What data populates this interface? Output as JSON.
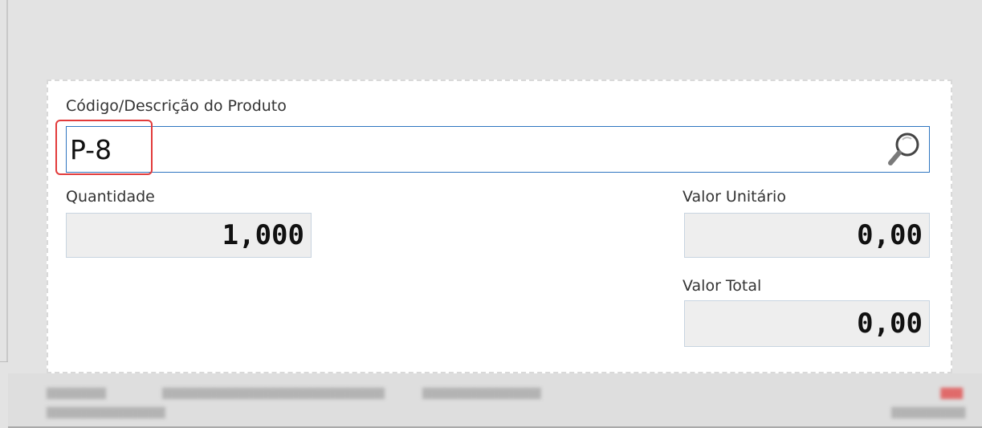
{
  "form": {
    "product_label": "Código/Descrição do Produto",
    "product_value": "P-8",
    "quantity_label": "Quantidade",
    "quantity_value": "1,000",
    "unit_price_label": "Valor Unitário",
    "unit_price_value": "0,00",
    "total_label": "Valor Total",
    "total_value": "0,00"
  },
  "icons": {
    "search": "search-icon"
  },
  "colors": {
    "input_border": "#2e75c0",
    "highlight": "#e23b3b",
    "value_box_bg": "#eeeeee"
  }
}
